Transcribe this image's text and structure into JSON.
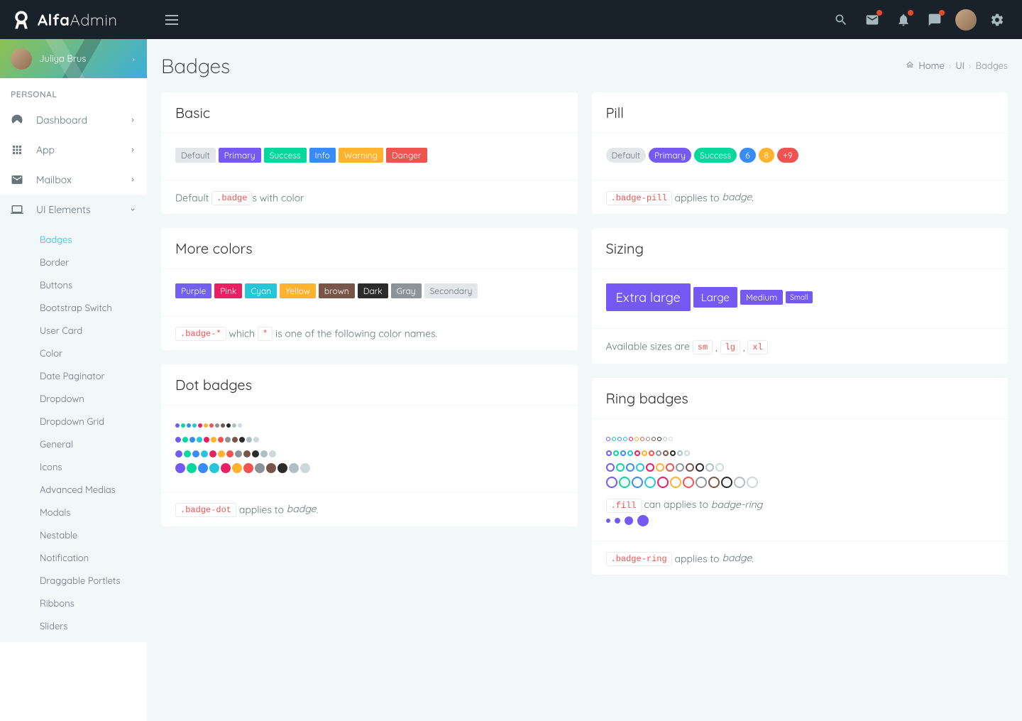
{
  "brand": {
    "bold": "Alfa",
    "light": "Admin"
  },
  "user": {
    "name": "Juliya Brus"
  },
  "sidebar": {
    "section": "PERSONAL",
    "items": [
      {
        "label": "Dashboard",
        "expandable": true
      },
      {
        "label": "App",
        "expandable": true
      },
      {
        "label": "Mailbox",
        "expandable": true
      },
      {
        "label": "UI Elements",
        "expandable": true,
        "open": true
      }
    ],
    "ui_elements_sub": [
      "Badges",
      "Border",
      "Buttons",
      "Bootstrap Switch",
      "User Card",
      "Color",
      "Date Paginator",
      "Dropdown",
      "Dropdown Grid",
      "General",
      "Icons",
      "Advanced Medias",
      "Modals",
      "Nestable",
      "Notification",
      "Draggable Portlets",
      "Ribbons",
      "Sliders"
    ]
  },
  "page": {
    "title": "Badges"
  },
  "breadcrumb": {
    "home": "Home",
    "mid": "UI",
    "current": "Badges"
  },
  "cards": {
    "basic": {
      "title": "Basic",
      "badges": [
        "Default",
        "Primary",
        "Success",
        "Info",
        "Warning",
        "Danger"
      ],
      "footer_prefix": "Default ",
      "footer_code": ".badge",
      "footer_suffix": "s with color"
    },
    "pill": {
      "title": "Pill",
      "badges": [
        {
          "label": "Default",
          "cls": "default"
        },
        {
          "label": "Primary",
          "cls": "primary"
        },
        {
          "label": "Success",
          "cls": "success"
        },
        {
          "label": "6",
          "cls": "info"
        },
        {
          "label": "8",
          "cls": "warning"
        },
        {
          "label": "+9",
          "cls": "danger"
        }
      ],
      "footer_code": ".badge-pill",
      "footer_text": " applies to ",
      "footer_em": "badge"
    },
    "more": {
      "title": "More colors",
      "badges": [
        {
          "label": "Purple",
          "cls": "purple"
        },
        {
          "label": "Pink",
          "cls": "pink"
        },
        {
          "label": "Cyan",
          "cls": "cyan"
        },
        {
          "label": "Yellow",
          "cls": "yellow"
        },
        {
          "label": "brown",
          "cls": "brown"
        },
        {
          "label": "Dark",
          "cls": "dark"
        },
        {
          "label": "Gray",
          "cls": "gray"
        },
        {
          "label": "Secondary",
          "cls": "secondary"
        }
      ],
      "footer_code": ".badge-*",
      "footer_mid": " which ",
      "footer_code2": "*",
      "footer_suffix": " is one of the following color names."
    },
    "sizing": {
      "title": "Sizing",
      "badges": [
        {
          "label": "Extra large",
          "size": "xl"
        },
        {
          "label": "Large",
          "size": "lg"
        },
        {
          "label": "Medium",
          "size": "md"
        },
        {
          "label": "Small",
          "size": "sm"
        }
      ],
      "footer_prefix": "Available sizes are ",
      "codes": [
        "sm",
        "lg",
        "xl"
      ]
    },
    "dot": {
      "title": "Dot badges",
      "footer_code": ".badge-dot",
      "footer_text": " applies to ",
      "footer_em": "badge"
    },
    "ring": {
      "title": "Ring badges",
      "fill_code": ".fill",
      "fill_text": " can applies to ",
      "fill_em": "badge-ring",
      "footer_code": ".badge-ring",
      "footer_text": " applies to ",
      "footer_em": "badge"
    }
  },
  "palette": [
    "#745af2",
    "#06d79c",
    "#398bf7",
    "#26c6da",
    "#e91e63",
    "#ffb22b",
    "#ef5350",
    "#8d9498",
    "#795548",
    "#2b2b2b",
    "#b0bec5",
    "#cfd8dc"
  ]
}
